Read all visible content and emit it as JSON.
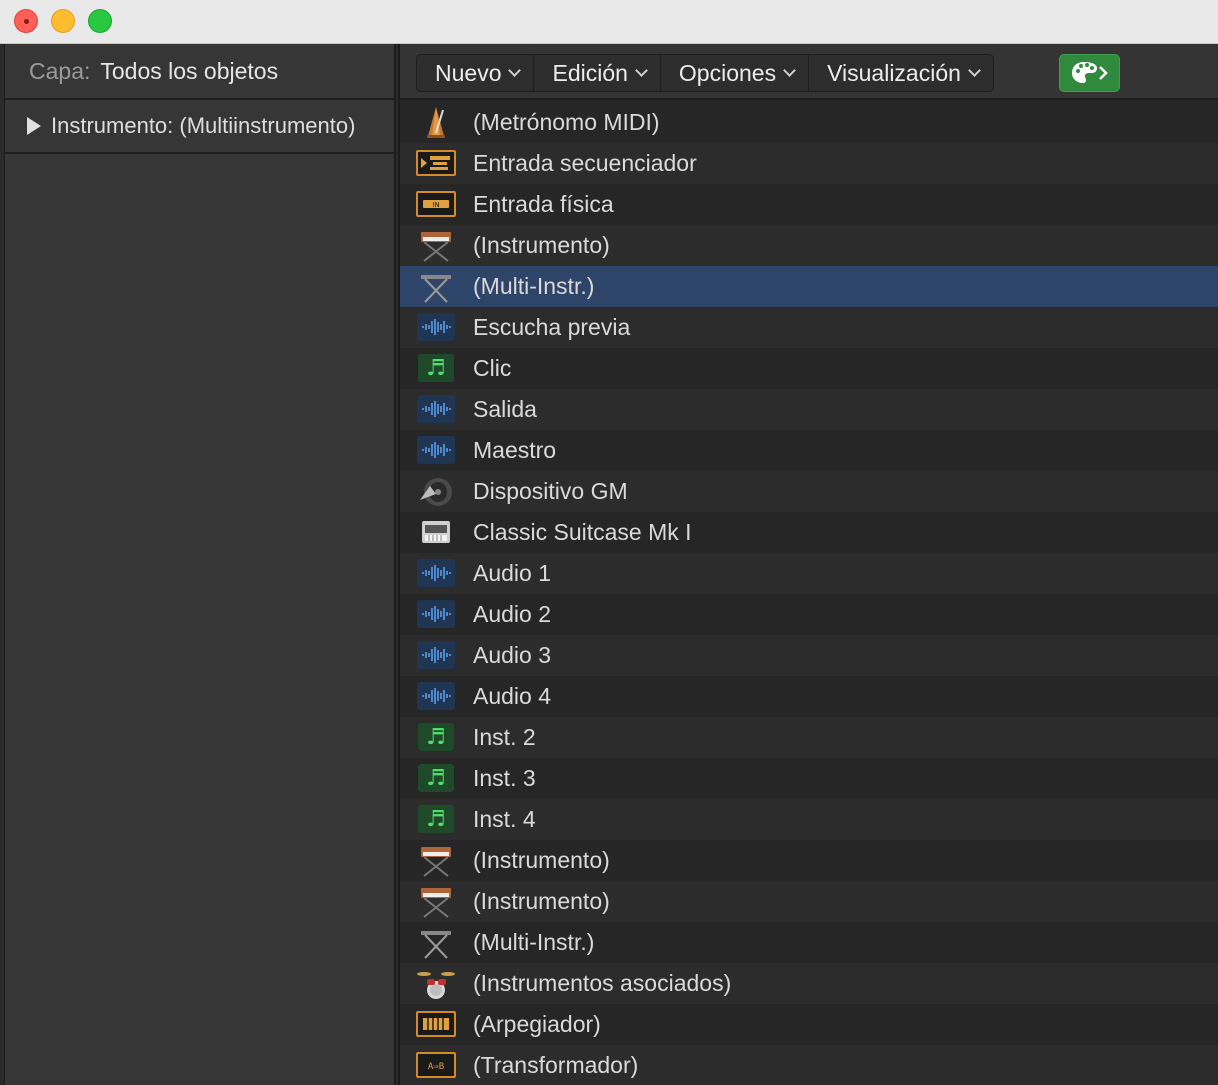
{
  "window": {
    "controls": [
      "close",
      "minimize",
      "maximize"
    ]
  },
  "left_panel": {
    "layer_label": "Capa:",
    "layer_value": "Todos los objetos",
    "tree_item": "Instrumento: (Multiinstrumento)"
  },
  "toolbar": {
    "menus": [
      {
        "label": "Nuevo"
      },
      {
        "label": "Edición"
      },
      {
        "label": "Opciones"
      },
      {
        "label": "Visualización"
      }
    ],
    "palette_button_icon": "palette-icon",
    "accent_color": "#2f8a3e"
  },
  "objects": [
    {
      "label": "(Metrónomo MIDI)",
      "icon": "metronome-icon"
    },
    {
      "label": "Entrada secuenciador",
      "icon": "sequencer-input-icon"
    },
    {
      "label": "Entrada física",
      "icon": "physical-input-icon"
    },
    {
      "label": "(Instrumento)",
      "icon": "keyboard-instrument-icon"
    },
    {
      "label": "(Multi-Instr.)",
      "icon": "keyboard-stand-icon",
      "selected": true
    },
    {
      "label": "Escucha previa",
      "icon": "audio-waveform-icon"
    },
    {
      "label": "Clic",
      "icon": "music-note-icon"
    },
    {
      "label": "Salida",
      "icon": "audio-waveform-icon"
    },
    {
      "label": "Maestro",
      "icon": "audio-waveform-icon"
    },
    {
      "label": "Dispositivo GM",
      "icon": "speaker-icon"
    },
    {
      "label": "Classic Suitcase Mk I",
      "icon": "electric-piano-icon"
    },
    {
      "label": "Audio 1",
      "icon": "audio-waveform-icon"
    },
    {
      "label": "Audio 2",
      "icon": "audio-waveform-icon"
    },
    {
      "label": "Audio 3",
      "icon": "audio-waveform-icon"
    },
    {
      "label": "Audio 4",
      "icon": "audio-waveform-icon"
    },
    {
      "label": "Inst. 2",
      "icon": "music-note-icon"
    },
    {
      "label": "Inst. 3",
      "icon": "music-note-icon"
    },
    {
      "label": "Inst. 4",
      "icon": "music-note-icon"
    },
    {
      "label": "(Instrumento)",
      "icon": "keyboard-instrument-icon"
    },
    {
      "label": "(Instrumento)",
      "icon": "keyboard-instrument-icon"
    },
    {
      "label": "(Multi-Instr.)",
      "icon": "keyboard-stand-icon"
    },
    {
      "label": "(Instrumentos asociados)",
      "icon": "drum-kit-icon"
    },
    {
      "label": "(Arpegiador)",
      "icon": "arpeggiator-icon"
    },
    {
      "label": "(Transformador)",
      "icon": "transformer-icon"
    }
  ]
}
